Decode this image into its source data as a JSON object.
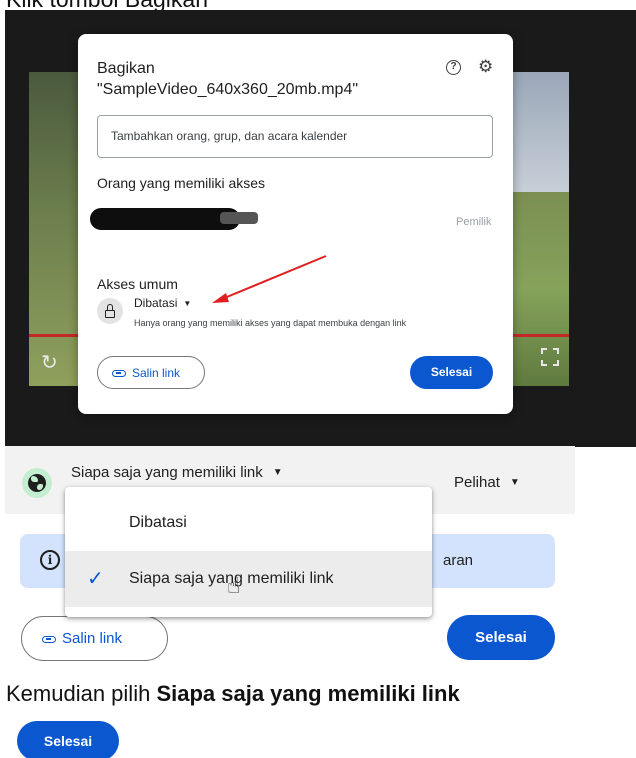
{
  "captions": {
    "top": "Klik tombol Bagikan",
    "bottom_prefix": "Kemudian pilih ",
    "bottom_bold": "Siapa saja yang memiliki link"
  },
  "share_dialog": {
    "title": "Bagikan",
    "filename": "\"SampleVideo_640x360_20mb.mp4\"",
    "help_icon": "help-circle-icon",
    "settings_icon": "gear-icon",
    "add_people_placeholder": "Tambahkan orang, grup, dan acara kalender",
    "people_with_access_label": "Orang yang memiliki akses",
    "owner_role": "Pemilik",
    "general_access_label": "Akses umum",
    "access_value": "Dibatasi",
    "access_description": "Hanya orang yang memiliki akses yang dapat membuka dengan link",
    "copy_link_label": "Salin link",
    "done_label": "Selesai",
    "accent_color": "#0b57d0"
  },
  "access_menu": {
    "current_value": "Siapa saja yang memiliki link",
    "role_value": "Pelihat",
    "banner_text": "aran",
    "options": [
      {
        "label": "Dibatasi",
        "selected": false
      },
      {
        "label": "Siapa saja yang memiliki link",
        "selected": true
      }
    ],
    "copy_link_label": "Salin link",
    "done_label": "Selesai"
  },
  "final_button": {
    "label": "Selesai"
  },
  "colors": {
    "primary": "#0b57d0",
    "globe_bg": "#c4eed0",
    "banner_bg": "#d3e3fd",
    "annotation_arrow": "#e02020"
  }
}
